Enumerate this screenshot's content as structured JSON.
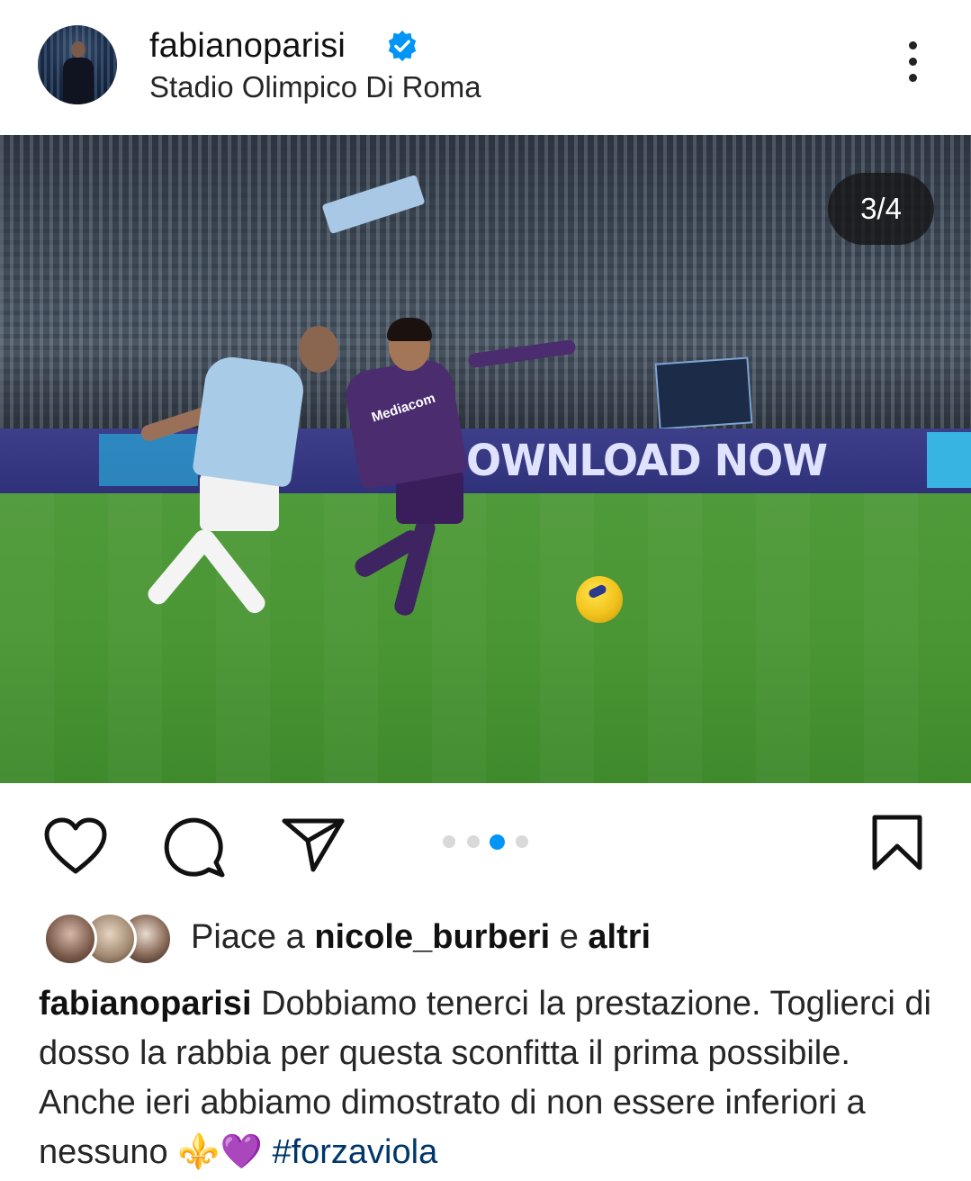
{
  "post": {
    "username": "fabianoparisi",
    "location": "Stadio Olimpico Di Roma",
    "verified": true
  },
  "media": {
    "counter": "3/4",
    "current_index": 3,
    "total": 4,
    "ad_board_text": "OWNLOAD NOW",
    "jersey_sponsor": "Mediacom"
  },
  "actions": {
    "icons": [
      "heart-icon",
      "comment-icon",
      "share-icon",
      "bookmark-icon"
    ],
    "dot_count": 4,
    "active_dot": 3,
    "accent_color": "#0095f6"
  },
  "likes": {
    "prefix": "Piace a",
    "user": "nicole_burberi",
    "conjunction": "e",
    "others": "altri"
  },
  "caption": {
    "username": "fabianoparisi",
    "text": "Dobbiamo tenerci la prestazione. Toglierci di dosso la rabbia per questa sconfitta il prima possibile. Anche ieri abbiamo dimostrato di non essere inferiori a nessuno",
    "emoji": "⚜️💜",
    "hashtag": "#forzaviola",
    "hashtag_color": "#00376b"
  }
}
